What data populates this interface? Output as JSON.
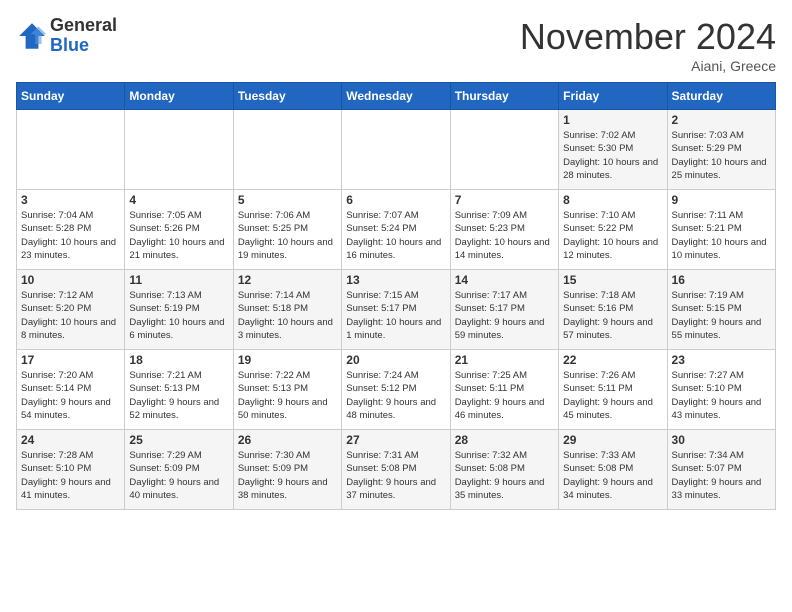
{
  "header": {
    "logo_line1": "General",
    "logo_line2": "Blue",
    "month_title": "November 2024",
    "location": "Aiani, Greece"
  },
  "days_of_week": [
    "Sunday",
    "Monday",
    "Tuesday",
    "Wednesday",
    "Thursday",
    "Friday",
    "Saturday"
  ],
  "weeks": [
    [
      {
        "day": "",
        "info": ""
      },
      {
        "day": "",
        "info": ""
      },
      {
        "day": "",
        "info": ""
      },
      {
        "day": "",
        "info": ""
      },
      {
        "day": "",
        "info": ""
      },
      {
        "day": "1",
        "info": "Sunrise: 7:02 AM\nSunset: 5:30 PM\nDaylight: 10 hours and 28 minutes."
      },
      {
        "day": "2",
        "info": "Sunrise: 7:03 AM\nSunset: 5:29 PM\nDaylight: 10 hours and 25 minutes."
      }
    ],
    [
      {
        "day": "3",
        "info": "Sunrise: 7:04 AM\nSunset: 5:28 PM\nDaylight: 10 hours and 23 minutes."
      },
      {
        "day": "4",
        "info": "Sunrise: 7:05 AM\nSunset: 5:26 PM\nDaylight: 10 hours and 21 minutes."
      },
      {
        "day": "5",
        "info": "Sunrise: 7:06 AM\nSunset: 5:25 PM\nDaylight: 10 hours and 19 minutes."
      },
      {
        "day": "6",
        "info": "Sunrise: 7:07 AM\nSunset: 5:24 PM\nDaylight: 10 hours and 16 minutes."
      },
      {
        "day": "7",
        "info": "Sunrise: 7:09 AM\nSunset: 5:23 PM\nDaylight: 10 hours and 14 minutes."
      },
      {
        "day": "8",
        "info": "Sunrise: 7:10 AM\nSunset: 5:22 PM\nDaylight: 10 hours and 12 minutes."
      },
      {
        "day": "9",
        "info": "Sunrise: 7:11 AM\nSunset: 5:21 PM\nDaylight: 10 hours and 10 minutes."
      }
    ],
    [
      {
        "day": "10",
        "info": "Sunrise: 7:12 AM\nSunset: 5:20 PM\nDaylight: 10 hours and 8 minutes."
      },
      {
        "day": "11",
        "info": "Sunrise: 7:13 AM\nSunset: 5:19 PM\nDaylight: 10 hours and 6 minutes."
      },
      {
        "day": "12",
        "info": "Sunrise: 7:14 AM\nSunset: 5:18 PM\nDaylight: 10 hours and 3 minutes."
      },
      {
        "day": "13",
        "info": "Sunrise: 7:15 AM\nSunset: 5:17 PM\nDaylight: 10 hours and 1 minute."
      },
      {
        "day": "14",
        "info": "Sunrise: 7:17 AM\nSunset: 5:17 PM\nDaylight: 9 hours and 59 minutes."
      },
      {
        "day": "15",
        "info": "Sunrise: 7:18 AM\nSunset: 5:16 PM\nDaylight: 9 hours and 57 minutes."
      },
      {
        "day": "16",
        "info": "Sunrise: 7:19 AM\nSunset: 5:15 PM\nDaylight: 9 hours and 55 minutes."
      }
    ],
    [
      {
        "day": "17",
        "info": "Sunrise: 7:20 AM\nSunset: 5:14 PM\nDaylight: 9 hours and 54 minutes."
      },
      {
        "day": "18",
        "info": "Sunrise: 7:21 AM\nSunset: 5:13 PM\nDaylight: 9 hours and 52 minutes."
      },
      {
        "day": "19",
        "info": "Sunrise: 7:22 AM\nSunset: 5:13 PM\nDaylight: 9 hours and 50 minutes."
      },
      {
        "day": "20",
        "info": "Sunrise: 7:24 AM\nSunset: 5:12 PM\nDaylight: 9 hours and 48 minutes."
      },
      {
        "day": "21",
        "info": "Sunrise: 7:25 AM\nSunset: 5:11 PM\nDaylight: 9 hours and 46 minutes."
      },
      {
        "day": "22",
        "info": "Sunrise: 7:26 AM\nSunset: 5:11 PM\nDaylight: 9 hours and 45 minutes."
      },
      {
        "day": "23",
        "info": "Sunrise: 7:27 AM\nSunset: 5:10 PM\nDaylight: 9 hours and 43 minutes."
      }
    ],
    [
      {
        "day": "24",
        "info": "Sunrise: 7:28 AM\nSunset: 5:10 PM\nDaylight: 9 hours and 41 minutes."
      },
      {
        "day": "25",
        "info": "Sunrise: 7:29 AM\nSunset: 5:09 PM\nDaylight: 9 hours and 40 minutes."
      },
      {
        "day": "26",
        "info": "Sunrise: 7:30 AM\nSunset: 5:09 PM\nDaylight: 9 hours and 38 minutes."
      },
      {
        "day": "27",
        "info": "Sunrise: 7:31 AM\nSunset: 5:08 PM\nDaylight: 9 hours and 37 minutes."
      },
      {
        "day": "28",
        "info": "Sunrise: 7:32 AM\nSunset: 5:08 PM\nDaylight: 9 hours and 35 minutes."
      },
      {
        "day": "29",
        "info": "Sunrise: 7:33 AM\nSunset: 5:08 PM\nDaylight: 9 hours and 34 minutes."
      },
      {
        "day": "30",
        "info": "Sunrise: 7:34 AM\nSunset: 5:07 PM\nDaylight: 9 hours and 33 minutes."
      }
    ]
  ]
}
